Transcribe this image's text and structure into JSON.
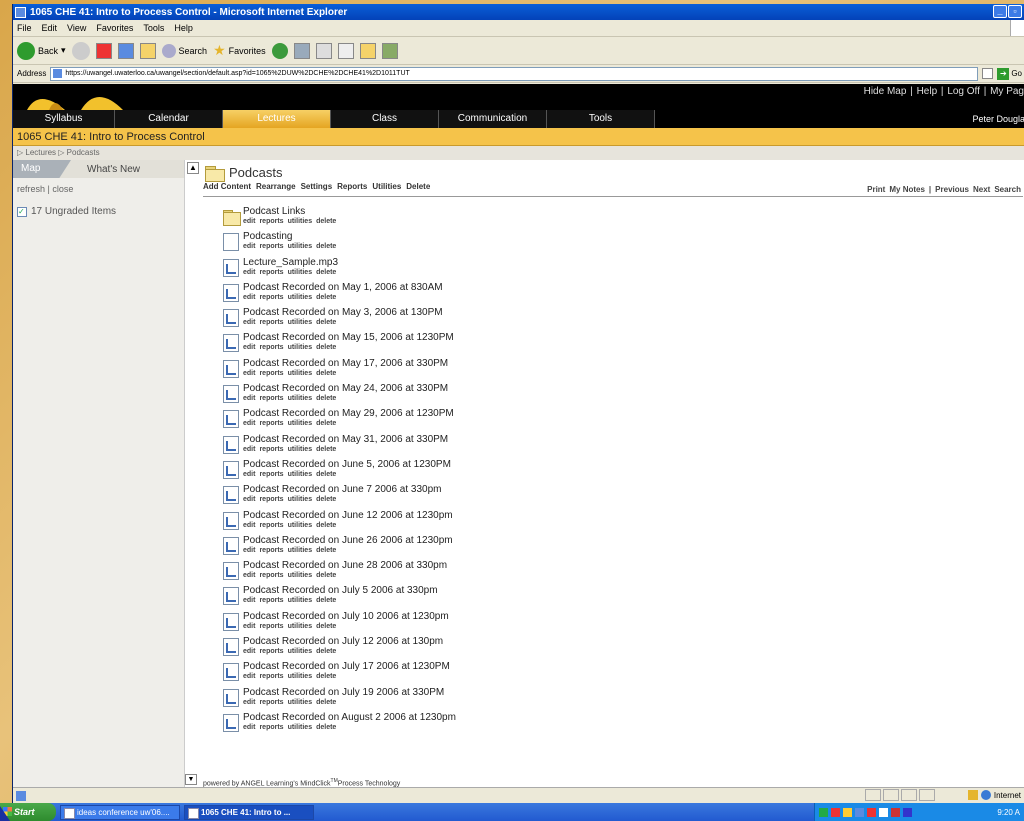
{
  "window": {
    "title": "1065 CHE 41: Intro to Process Control - Microsoft Internet Explorer",
    "menu": [
      "File",
      "Edit",
      "View",
      "Favorites",
      "Tools",
      "Help"
    ],
    "toolbar": {
      "back": "Back",
      "search": "Search",
      "favorites": "Favorites"
    },
    "address_label": "Address",
    "address_url": "https://uwangel.uwaterloo.ca/uwangel/section/default.asp?id=1065%2DUW%2DCHE%2DCHE41%2D1011TUT",
    "go_label": "Go"
  },
  "banner": {
    "links": [
      "Hide Map",
      "Help",
      "Log Off",
      "My Pag"
    ],
    "user": "Peter Dougla"
  },
  "nav_tabs": [
    {
      "label": "Syllabus",
      "active": false
    },
    {
      "label": "Calendar",
      "active": false
    },
    {
      "label": "Lectures",
      "active": true
    },
    {
      "label": "Class",
      "active": false
    },
    {
      "label": "Communication",
      "active": false
    },
    {
      "label": "Tools",
      "active": false
    }
  ],
  "course_title": "1065 CHE 41: Intro to Process Control",
  "breadcrumb": "▷ Lectures ▷ Podcasts",
  "sidebar": {
    "tab_map": "Map",
    "tab_whats_new": "What's New",
    "refresh": "refresh",
    "close": "close",
    "ungraded": "17 Ungraded Items"
  },
  "main": {
    "title": "Podcasts",
    "actions": [
      "Add Content",
      "Rearrange",
      "Settings",
      "Reports",
      "Utilities",
      "Delete"
    ],
    "right_actions": [
      "Print",
      "My Notes",
      "|",
      "Previous",
      "Next",
      "Search"
    ],
    "item_actions": [
      "edit",
      "reports",
      "utilities",
      "delete"
    ],
    "items": [
      {
        "title": "Podcast Links",
        "icon": "folder-icon"
      },
      {
        "title": "Podcasting",
        "icon": "document-icon"
      },
      {
        "title": "Lecture_Sample.mp3",
        "icon": "file-icon"
      },
      {
        "title": "Podcast Recorded on May 1, 2006 at 830AM",
        "icon": "file-icon"
      },
      {
        "title": "Podcast Recorded on May 3, 2006 at 130PM",
        "icon": "file-icon"
      },
      {
        "title": "Podcast Recorded on May 15, 2006 at 1230PM",
        "icon": "file-icon"
      },
      {
        "title": "Podcast Recorded on May 17, 2006 at 330PM",
        "icon": "file-icon"
      },
      {
        "title": "Podcast Recorded on May 24, 2006 at 330PM",
        "icon": "file-icon"
      },
      {
        "title": "Podcast Recorded on May 29, 2006 at 1230PM",
        "icon": "file-icon"
      },
      {
        "title": "Podcast Recorded on May 31, 2006 at 330PM",
        "icon": "file-icon"
      },
      {
        "title": "Podcast Recorded on June 5, 2006 at 1230PM",
        "icon": "file-icon"
      },
      {
        "title": "Podcast Recorded on June 7 2006 at 330pm",
        "icon": "file-icon"
      },
      {
        "title": "Podcast Recorded on June 12 2006 at 1230pm",
        "icon": "file-icon"
      },
      {
        "title": "Podcast Recorded on June 26 2006 at 1230pm",
        "icon": "file-icon"
      },
      {
        "title": "Podcast Recorded on June 28 2006 at 330pm",
        "icon": "file-icon"
      },
      {
        "title": "Podcast Recorded on July 5 2006 at 330pm",
        "icon": "file-icon"
      },
      {
        "title": "Podcast Recorded on July 10 2006 at 1230pm",
        "icon": "file-icon"
      },
      {
        "title": "Podcast Recorded on July 12 2006 at 130pm",
        "icon": "file-icon"
      },
      {
        "title": "Podcast Recorded on July 17 2006 at 1230PM",
        "icon": "file-icon"
      },
      {
        "title": "Podcast Recorded on July 19 2006 at 330PM",
        "icon": "file-icon"
      },
      {
        "title": "Podcast Recorded on August 2 2006 at 1230pm",
        "icon": "file-icon"
      }
    ]
  },
  "footer": {
    "prefix": "powered by ANGEL Learning's MindClick",
    "tm": "TM",
    "suffix": "Process Technology"
  },
  "statusbar": {
    "zone": "Internet"
  },
  "taskbar": {
    "start": "Start",
    "tasks": [
      {
        "label": "ideas conference uw'06....",
        "active": false
      },
      {
        "label": "1065 CHE 41: Intro to ...",
        "active": true
      }
    ],
    "clock": "9:20 A"
  }
}
